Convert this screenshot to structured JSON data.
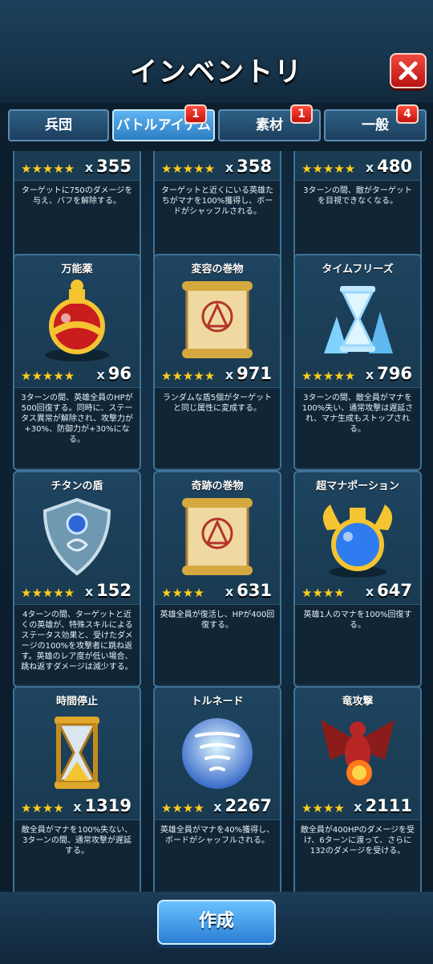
{
  "header": {
    "title": "インベントリ"
  },
  "tabs": [
    {
      "label": "兵団",
      "badge": ""
    },
    {
      "label": "バトルアイテム",
      "badge": "1"
    },
    {
      "label": "素材",
      "badge": "1"
    },
    {
      "label": "一般",
      "badge": "4"
    }
  ],
  "items": [
    {
      "name": "",
      "stars": "★★★★★",
      "qty": "355",
      "desc": "ターゲットに750のダメージを与え、バフを解除する。",
      "icon": "unknown-item-icon"
    },
    {
      "name": "",
      "stars": "★★★★★",
      "qty": "358",
      "desc": "ターゲットと近くにいる英雄たちがマナを100%獲得し、ボードがシャッフルされる。",
      "icon": "unknown-item-icon"
    },
    {
      "name": "",
      "stars": "★★★★★",
      "qty": "480",
      "desc": "3ターンの間、敵がターゲットを目視できなくなる。",
      "icon": "unknown-item-icon"
    },
    {
      "name": "万能薬",
      "stars": "★★★★★",
      "qty": "96",
      "desc": "3ターンの間、英雄全員のHPが500回復する。同時に、ステータス異常が解除され、攻撃力が+30%、防御力が+30%になる。",
      "icon": "potion-icon"
    },
    {
      "name": "変容の巻物",
      "stars": "★★★★★",
      "qty": "971",
      "desc": "ランダムな盾5個がターゲットと同じ属性に変成する。",
      "icon": "scroll-icon"
    },
    {
      "name": "タイムフリーズ",
      "stars": "★★★★★",
      "qty": "796",
      "desc": "3ターンの間、敵全員がマナを100%失い、通常攻撃は遅延され、マナ生成もストップされる。",
      "icon": "frozen-hourglass-icon"
    },
    {
      "name": "チタンの盾",
      "stars": "★★★★★",
      "qty": "152",
      "desc": "4ターンの間、ターゲットと近くの英雄が、特殊スキルによるステータス効果と、受けたダメージの100%を攻撃者に跳ね返す。英雄のレア度が低い場合、跳ね返すダメージは減少する。",
      "icon": "shield-icon"
    },
    {
      "name": "奇跡の巻物",
      "stars": "★★★★",
      "qty": "631",
      "desc": "英雄全員が復活し、HPが400回復する。",
      "icon": "scroll-icon"
    },
    {
      "name": "超マナポーション",
      "stars": "★★★★",
      "qty": "647",
      "desc": "英雄1人のマナを100%回復する。",
      "icon": "mana-potion-icon"
    },
    {
      "name": "時間停止",
      "stars": "★★★★",
      "qty": "1319",
      "desc": "敵全員がマナを100%失ない、3ターンの間、通常攻撃が遅延する。",
      "icon": "hourglass-icon"
    },
    {
      "name": "トルネード",
      "stars": "★★★★",
      "qty": "2267",
      "desc": "英雄全員がマナを40%獲得し、ボードがシャッフルされる。",
      "icon": "tornado-orb-icon"
    },
    {
      "name": "竜攻撃",
      "stars": "★★★★",
      "qty": "2111",
      "desc": "敵全員が400HPのダメージを受け、6ターンに渡って、さらに132のダメージを受ける。",
      "icon": "dragon-icon"
    }
  ],
  "footer": {
    "create_label": "作成"
  },
  "qty_prefix": "x"
}
